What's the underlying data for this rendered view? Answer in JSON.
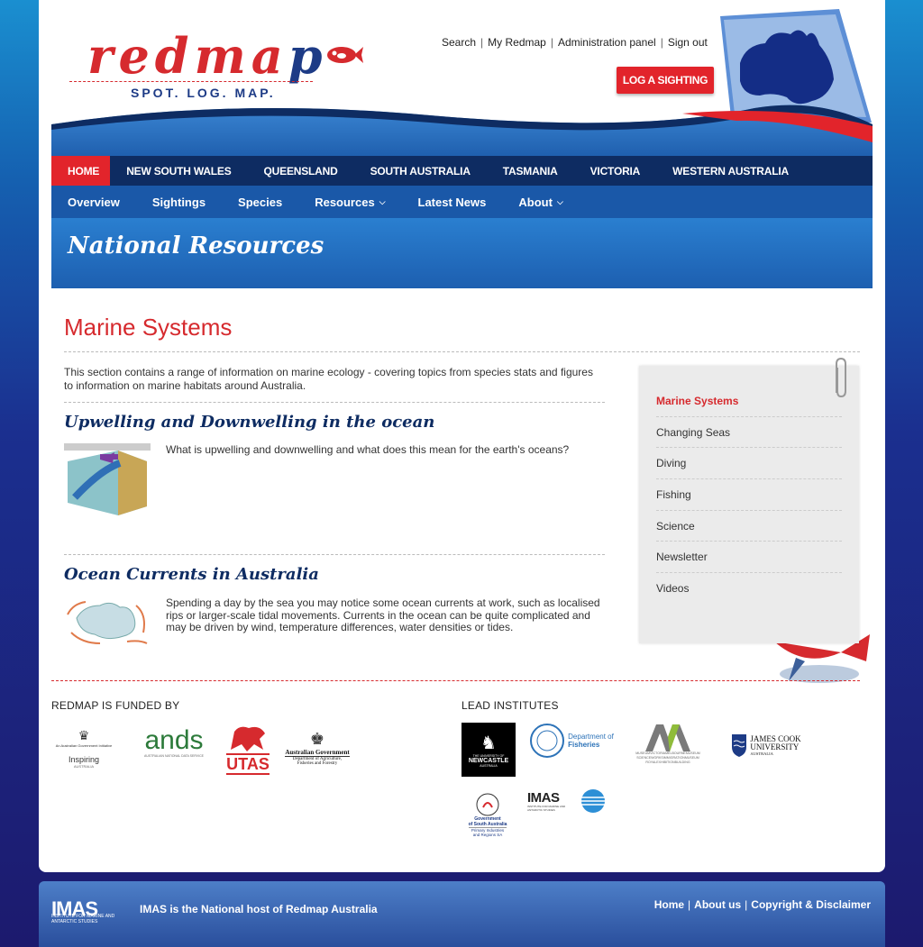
{
  "header": {
    "logo_word_red": "redma",
    "logo_word_p": "p",
    "tagline": "SPOT. LOG. MAP.",
    "toplinks": [
      "Search",
      "My Redmap",
      "Administration panel",
      "Sign out"
    ],
    "log_button": "LOG A SIGHTING"
  },
  "nav": {
    "regions": [
      "HOME",
      "NEW SOUTH WALES",
      "QUEENSLAND",
      "SOUTH AUSTRALIA",
      "TASMANIA",
      "VICTORIA",
      "WESTERN AUSTRALIA"
    ],
    "sub": [
      "Overview",
      "Sightings",
      "Species",
      "Resources",
      "Latest News",
      "About"
    ]
  },
  "banner": {
    "title": "National Resources"
  },
  "main": {
    "title": "Marine Systems",
    "intro": "This section contains a range of information on marine ecology - covering topics from species stats and figures to information on marine habitats around Australia.",
    "articles": [
      {
        "title": "Upwelling and Downwelling in the ocean",
        "text": "What is upwelling and downwelling and what does this mean for the earth's oceans?"
      },
      {
        "title": "Ocean Currents in Australia",
        "text": "Spending a day by the sea you may notice some ocean currents at work, such as localised rips or larger-scale tidal movements. Currents in the ocean can be quite complicated and may be driven by wind, temperature differences, water densities or tides."
      }
    ]
  },
  "sidebar": {
    "items": [
      "Marine Systems",
      "Changing Seas",
      "Diving",
      "Fishing",
      "Science",
      "Newsletter",
      "Videos"
    ],
    "active": "Marine Systems"
  },
  "funders": {
    "heading": "REDMAP IS FUNDED BY",
    "logos": {
      "inspiring_top": "An Australian Government Initiative",
      "inspiring": "Inspiring",
      "inspiring_sub": "AUSTRALIA",
      "ands": "ands",
      "ands_sub": "AUSTRALIAN NATIONAL DATA SERVICE",
      "utas": "UTAS",
      "gov": "Australian Government",
      "gov_dept": "Department of Agriculture, Fisheries and Forestry"
    }
  },
  "institutes": {
    "heading": "LEAD INSTITUTES",
    "logos": {
      "newcastle_1": "THE UNIVERSITY OF",
      "newcastle_2": "NEWCASTLE",
      "newcastle_3": "AUSTRALIA",
      "fisheries_1": "Department of",
      "fisheries_2": "Fisheries",
      "museum": "MUSEUMVICTORIAMELBOURNEMUSEUM SCIENCEWORKSIMMIGRATIONMUSEUM ROYALEXHIBITIONBUILDING",
      "jcu_1": "JAMES COOK",
      "jcu_2": "UNIVERSITY",
      "jcu_3": "AUSTRALIA",
      "sa_1": "Government",
      "sa_2": "of South Australia",
      "sa_3": "Primary Industries",
      "sa_4": "and Regions SA",
      "imas": "IMAS",
      "imas_sub": "INSTITUTE FOR MARINE AND ANTARCTIC STUDIES"
    }
  },
  "footer": {
    "logo": "IMAS",
    "logo_sub": "INSTITUTE FOR MARINE AND ANTARCTIC STUDIES",
    "text": "IMAS is the National host of Redmap Australia",
    "links": [
      "Home",
      "About us",
      "Copyright & Disclaimer"
    ]
  },
  "colors": {
    "accent_red": "#d62a2e",
    "navy": "#0e2c62",
    "blue": "#1a58a8"
  }
}
